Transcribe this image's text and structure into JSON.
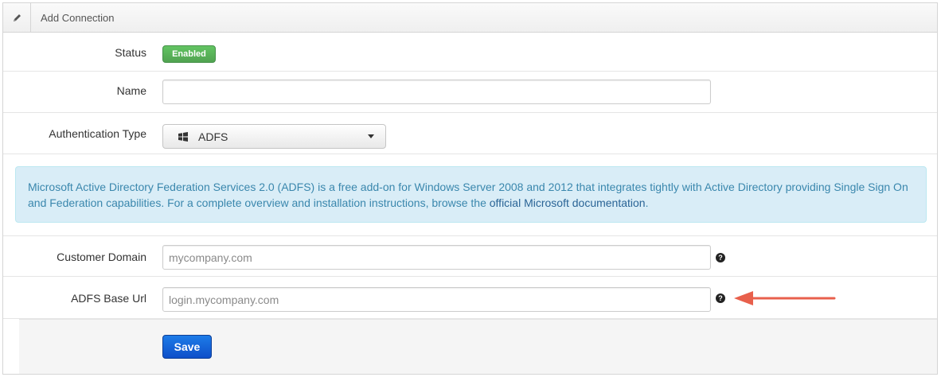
{
  "header": {
    "icon": "pencil-icon",
    "title": "Add Connection"
  },
  "status": {
    "label": "Status",
    "badge": "Enabled",
    "badge_color": "#5bb75b"
  },
  "name": {
    "label": "Name",
    "value": ""
  },
  "auth_type": {
    "label": "Authentication Type",
    "icon": "windows-icon",
    "selected": "ADFS"
  },
  "info": {
    "text": "Microsoft Active Directory Federation Services 2.0 (ADFS) is a free add-on for Windows Server 2008 and 2012 that integrates tightly with Active Directory providing Single Sign On and Federation capabilities. For a complete overview and installation instructions, browse the ",
    "link": "official Microsoft documentation",
    "suffix": "."
  },
  "customer_domain": {
    "label": "Customer Domain",
    "placeholder": "mycompany.com",
    "help": "?"
  },
  "adfs_base_url": {
    "label": "ADFS Base Url",
    "placeholder": "login.mycompany.com",
    "help": "?"
  },
  "annotation": {
    "arrow_color": "#e8604c"
  },
  "actions": {
    "save_label": "Save",
    "save_color": "#1560d6"
  }
}
